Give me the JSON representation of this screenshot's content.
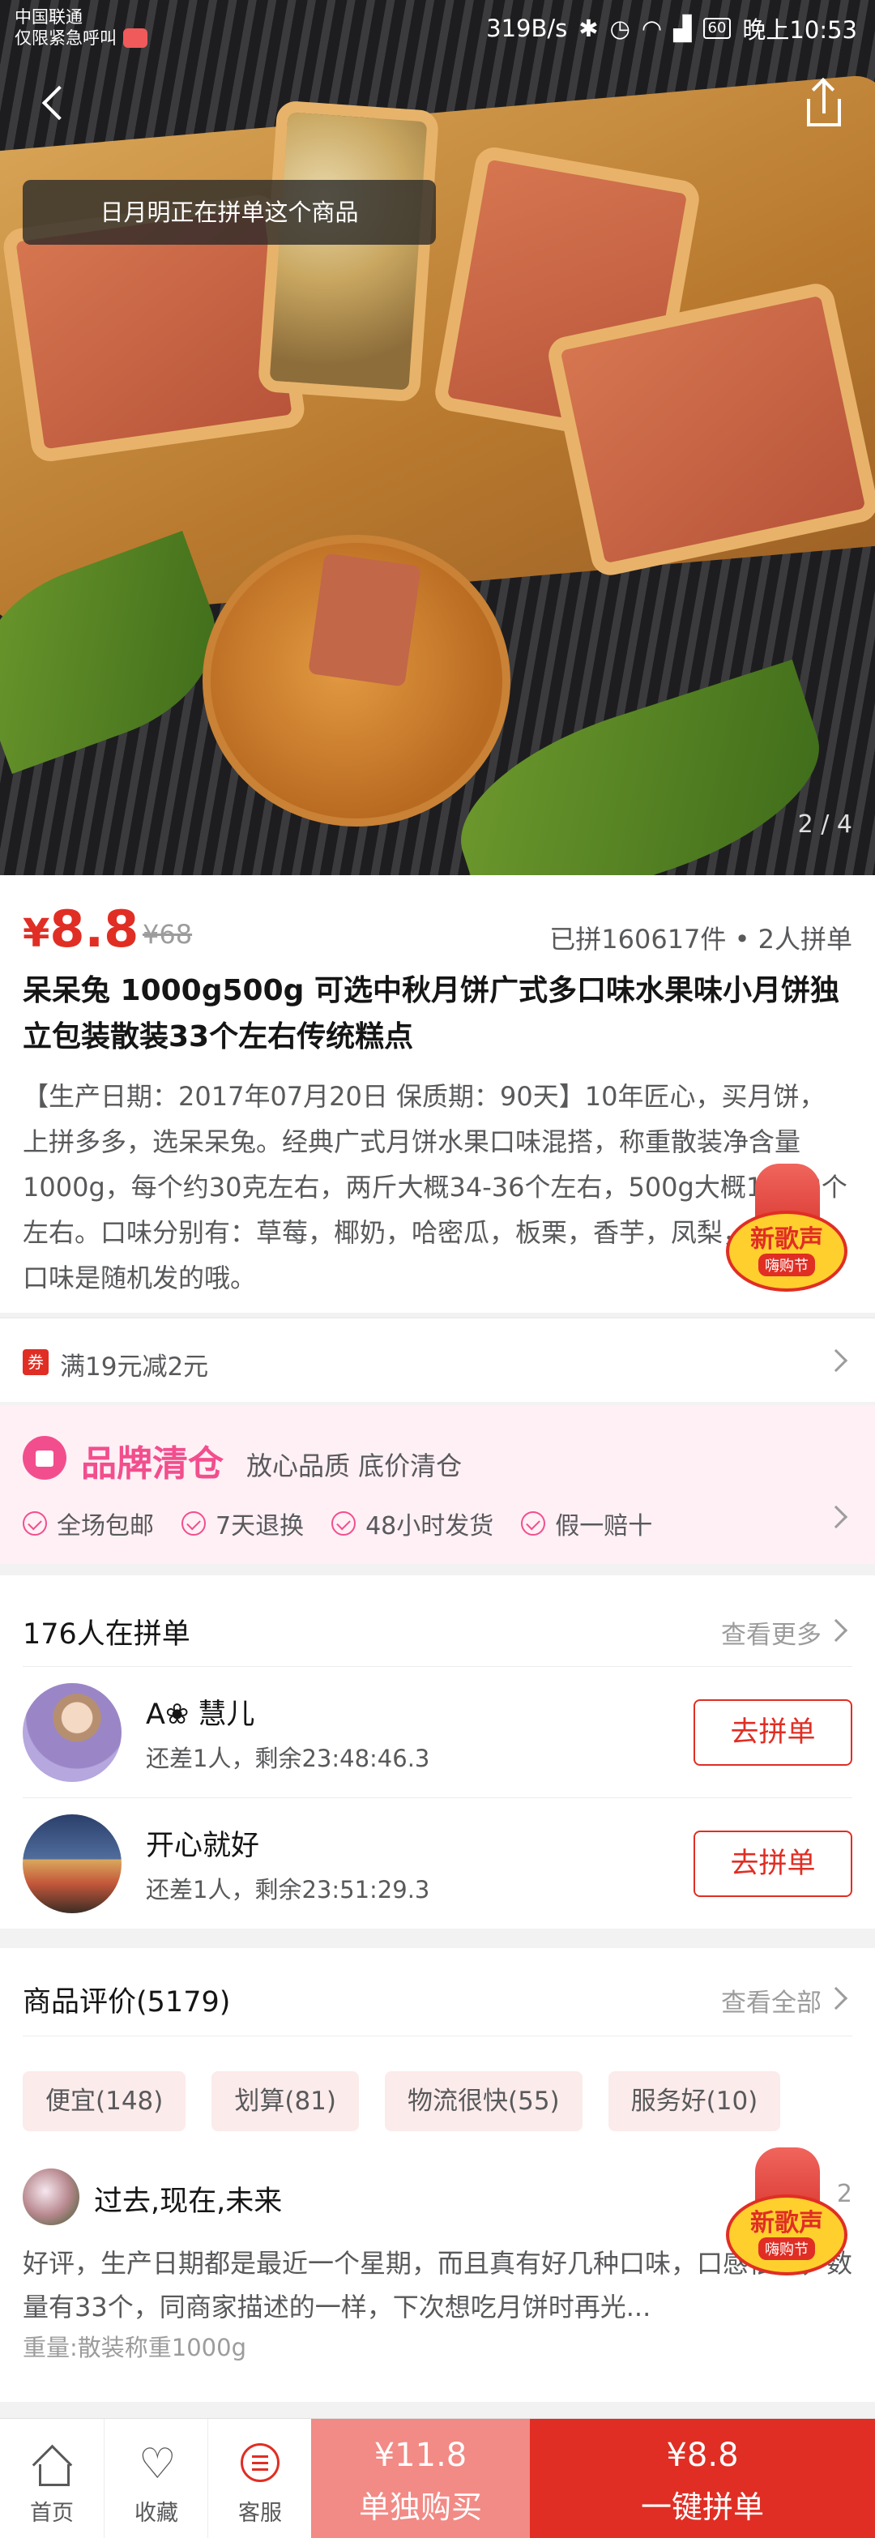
{
  "status_bar": {
    "carrier": "中国联通",
    "carrier_note": "仅限紧急呼叫",
    "speed": "319B/s",
    "battery": "60",
    "time": "晚上10:53",
    "icons": [
      "bluetooth-icon",
      "alarm-icon",
      "wifi-icon",
      "signal-icon",
      "battery-icon"
    ]
  },
  "hero": {
    "toast": "日月明正在拼单这个商品",
    "counter": "2 / 4"
  },
  "product": {
    "price_symbol": "¥",
    "price": "8.8",
    "original_price": "¥68",
    "sold_info": "已拼160617件 • 2人拼单",
    "title": "呆呆兔 1000g500g 可选中秋月饼广式多口味水果味小月饼独立包装散装33个左右传统糕点",
    "description": "【生产日期：2017年07月20日 保质期：90天】10年匠心，买月饼，上拼多多，选呆呆兔。经典广式月饼水果口味混搭，称重散装净含量1000g，每个约30克左右，两斤大概34-36个左右，500g大概16-18个左右。口味分别有：草莓，椰奶，哈密瓜，板栗，香芋，凤梨，五仁。口味是随机发的哦。"
  },
  "coupon": {
    "tag": "券",
    "text": "满19元减2元"
  },
  "brand": {
    "name": "品牌清仓",
    "slogan": "放心品质 底价清仓",
    "features": [
      "全场包邮",
      "7天退换",
      "48小时发货",
      "假一赔十"
    ]
  },
  "groups": {
    "title": "176人在拼单",
    "more": "查看更多",
    "join_label": "去拼单",
    "items": [
      {
        "name": "A❀ 慧儿",
        "sub": "还差1人，剩余23:48:46.3"
      },
      {
        "name": "开心就好",
        "sub": "还差1人，剩余23:51:29.3"
      }
    ]
  },
  "reviews": {
    "title": "商品评价(5179)",
    "more": "查看全部",
    "tags": [
      "便宜(148)",
      "划算(81)",
      "物流很快(55)",
      "服务好(10)"
    ],
    "user": "过去,现在,未来",
    "date": "2",
    "text": "好评，生产日期都是最近一个星期，而且真有好几种口味，口感很甜，数量有33个，同商家描述的一样，下次想吃月饼时再光...",
    "spec": "重量:散装称重1000g"
  },
  "promo": {
    "line1": "新歌声",
    "line2": "嗨购节"
  },
  "bottom_bar": {
    "home": "首页",
    "favorite": "收藏",
    "service": "客服",
    "single_price": "¥11.8",
    "single_label": "单独购买",
    "group_price": "¥8.8",
    "group_label": "一键拼单"
  },
  "colors": {
    "accent": "#e02e24",
    "brand_pink": "#f24e8e",
    "single_buy": "#f28a85"
  }
}
